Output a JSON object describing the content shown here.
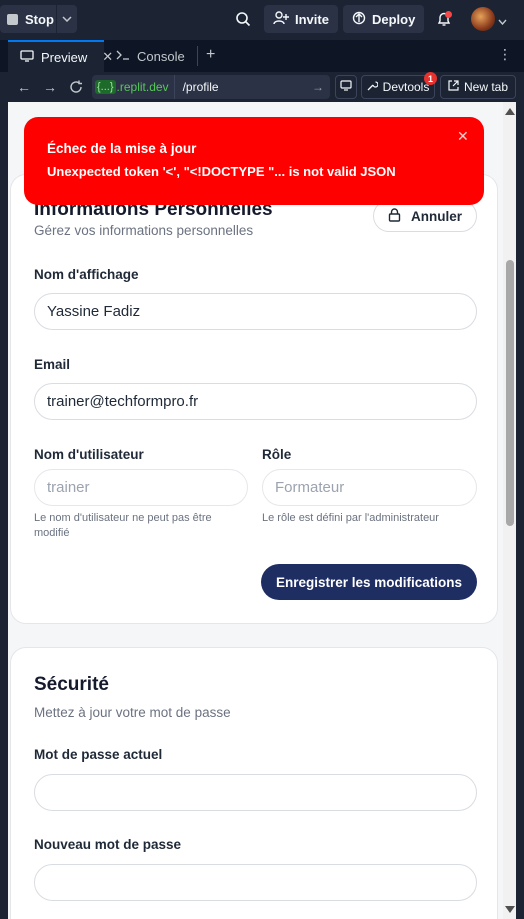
{
  "topbar": {
    "stop_label": "Stop",
    "invite_label": "Invite",
    "deploy_label": "Deploy"
  },
  "tabs": {
    "preview_label": "Preview",
    "console_label": "Console"
  },
  "address": {
    "domain_badge": "{...}",
    "domain": ".replit.dev",
    "path": "/profile",
    "devtools_label": "Devtools",
    "devtools_count": "1",
    "new_tab_label": "New tab"
  },
  "toast": {
    "title": "Échec de la mise à jour",
    "message": "Unexpected token '<', \"<!DOCTYPE \"... is not valid JSON",
    "color": "#ff0000"
  },
  "personal": {
    "title": "Informations Personnelles",
    "subtitle": "Gérez vos informations personnelles",
    "cancel_label": "Annuler",
    "display_name_label": "Nom d'affichage",
    "display_name_value": "Yassine Fadiz",
    "email_label": "Email",
    "email_value": "trainer@techformpro.fr",
    "username_label": "Nom d'utilisateur",
    "username_value": "trainer",
    "username_hint": "Le nom d'utilisateur ne peut pas être modifié",
    "role_label": "Rôle",
    "role_value": "Formateur",
    "role_hint": "Le rôle est défini par l'administrateur",
    "save_label": "Enregistrer les modifications"
  },
  "security": {
    "title": "Sécurité",
    "subtitle": "Mettez à jour votre mot de passe",
    "current_password_label": "Mot de passe actuel",
    "current_password_value": "",
    "new_password_label": "Nouveau mot de passe",
    "new_password_value": ""
  },
  "colors": {
    "primary_button": "#1e2e63",
    "toast_error": "#ff0000",
    "ide_background": "#1c2333"
  }
}
